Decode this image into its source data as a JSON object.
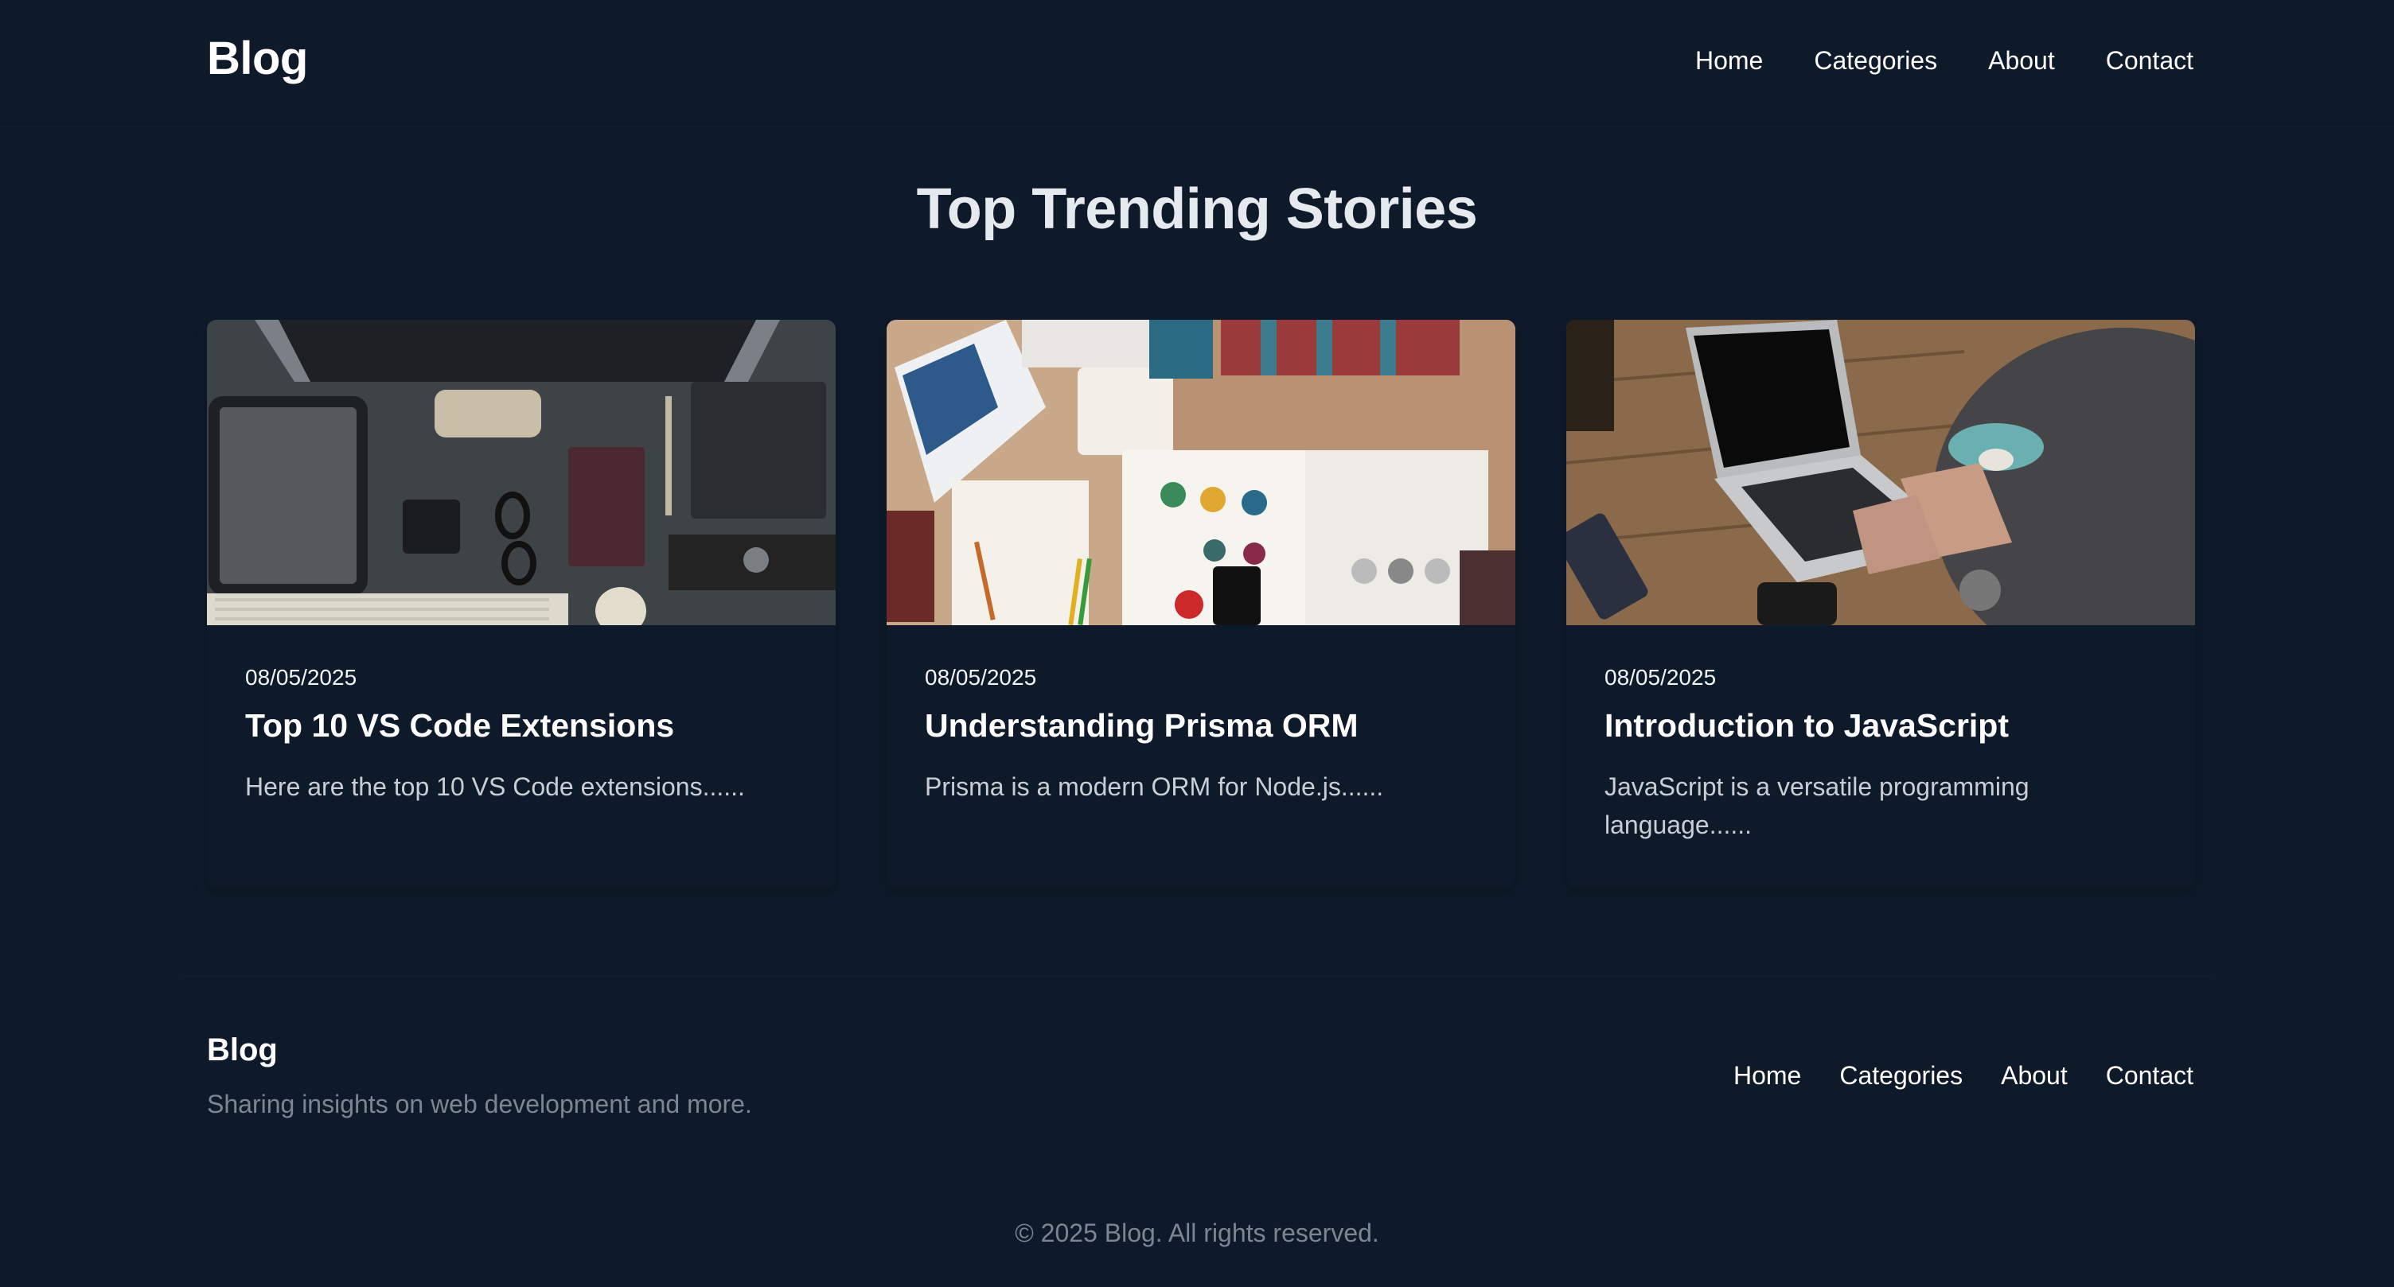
{
  "header": {
    "brand": "Blog",
    "nav": [
      "Home",
      "Categories",
      "About",
      "Contact"
    ]
  },
  "main": {
    "title": "Top Trending Stories",
    "cards": [
      {
        "date": "08/05/2025",
        "title": "Top 10 VS Code Extensions",
        "excerpt": "Here are the top 10 VS Code extensions......"
      },
      {
        "date": "08/05/2025",
        "title": "Understanding Prisma ORM",
        "excerpt": "Prisma is a modern ORM for Node.js......"
      },
      {
        "date": "08/05/2025",
        "title": "Introduction to JavaScript",
        "excerpt": "JavaScript is a versatile programming language......"
      }
    ]
  },
  "footer": {
    "brand": "Blog",
    "tagline": "Sharing insights on web development and more.",
    "nav": [
      "Home",
      "Categories",
      "About",
      "Contact"
    ],
    "copyright": "© 2025 Blog. All rights reserved."
  },
  "colors": {
    "background": "#0e1a2a",
    "text": "#ffffff",
    "muted": "#7b8594",
    "excerpt": "#c9ced6"
  }
}
